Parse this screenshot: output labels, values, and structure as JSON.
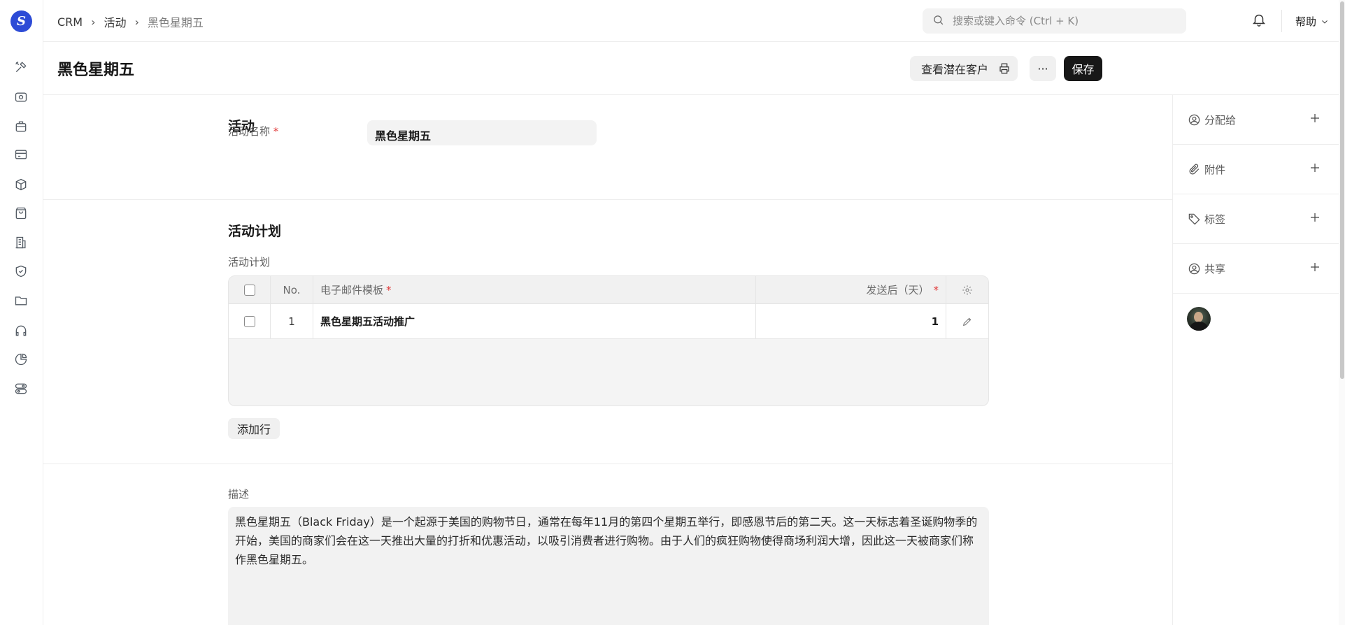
{
  "app": {
    "logo_letter": "S"
  },
  "breadcrumbs": [
    "CRM",
    "活动",
    "黑色星期五"
  ],
  "search": {
    "placeholder": "搜索或键入命令 (Ctrl + K)"
  },
  "navbar": {
    "help_label": "帮助"
  },
  "page": {
    "title": "黑色星期五",
    "view_leads_label": "查看潜在客户",
    "save_label": "保存",
    "more_label": "···"
  },
  "section_campaign": {
    "heading": "活动",
    "name_label": "活动名称",
    "name_value": "黑色星期五",
    "required_mark": "*"
  },
  "section_schedule": {
    "heading": "活动计划",
    "table_label": "活动计划",
    "columns": {
      "no": "No.",
      "email_template": "电子邮件模板",
      "send_after": "发送后（天）"
    },
    "rows": [
      {
        "no": "1",
        "email_template": "黑色星期五活动推广",
        "send_after": "1"
      }
    ],
    "add_row_label": "添加行"
  },
  "section_description": {
    "label": "描述",
    "text": "黑色星期五（Black Friday）是一个起源于美国的购物节日，通常在每年11月的第四个星期五举行，即感恩节后的第二天。这一天标志着圣诞购物季的开始，美国的商家们会在这一天推出大量的打折和优惠活动，以吸引消费者进行购物。由于人们的疯狂购物使得商场利润大增，因此这一天被商家们称作黑色星期五。"
  },
  "sidebar": {
    "items": [
      {
        "label": "分配给",
        "icon": "assign-user-icon"
      },
      {
        "label": "附件",
        "icon": "paperclip-icon"
      },
      {
        "label": "标签",
        "icon": "tag-icon"
      },
      {
        "label": "共享",
        "icon": "share-user-icon"
      }
    ]
  },
  "colors": {
    "accent_dark": "#171717",
    "brand": "#2d4bd6",
    "required": "#e03636"
  }
}
